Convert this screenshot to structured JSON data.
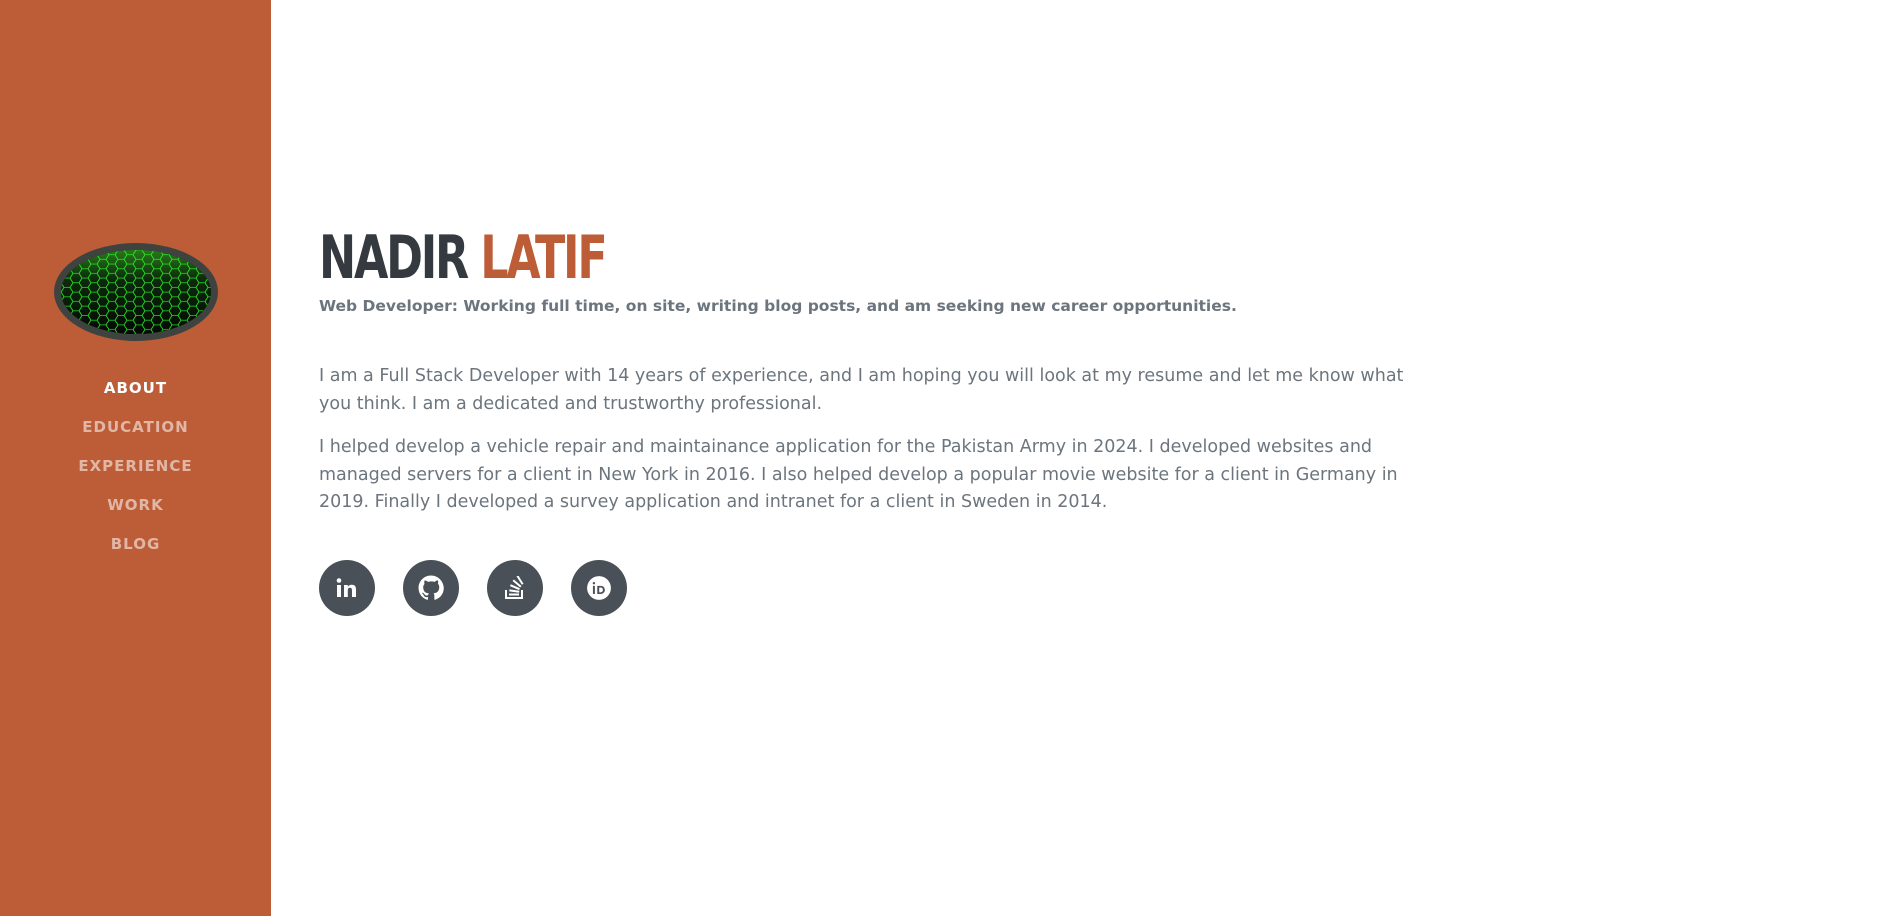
{
  "sidebar": {
    "avatar_alt": "profile image",
    "nav": [
      {
        "label": "ABOUT",
        "active": true
      },
      {
        "label": "EDUCATION",
        "active": false
      },
      {
        "label": "EXPERIENCE",
        "active": false
      },
      {
        "label": "WORK",
        "active": false
      },
      {
        "label": "BLOG",
        "active": false
      }
    ]
  },
  "header": {
    "first_name": "NADIR",
    "last_name": "LATIF",
    "subheading": "Web Developer: Working full time, on site, writing blog posts, and am seeking new career opportunities."
  },
  "about": {
    "paragraph1": "I am a Full Stack Developer with 14 years of experience, and I am hoping you will look at my resume and let me know what you think. I am a dedicated and trustworthy professional.",
    "paragraph2": "I helped develop a vehicle repair and maintainance application for the Pakistan Army in 2024. I developed websites and managed servers for a client in New York in 2016. I also helped develop a popular movie website for a client in Germany in 2019. Finally I developed a survey application and intranet for a client in Sweden in 2014."
  },
  "social": [
    {
      "icon": "linkedin-icon"
    },
    {
      "icon": "github-icon"
    },
    {
      "icon": "stackoverflow-icon"
    },
    {
      "icon": "orcid-icon"
    }
  ],
  "colors": {
    "accent": "#bd5d38",
    "heading": "#343a40",
    "muted": "#6c757d",
    "social_bg": "#495057"
  }
}
